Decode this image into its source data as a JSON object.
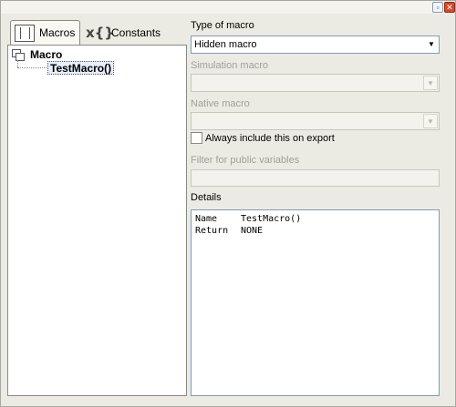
{
  "window": {
    "restore_glyph": "▫",
    "close_glyph": "✕"
  },
  "left": {
    "tabs": [
      {
        "label": "Macros",
        "icon": "macros-icon",
        "active": true
      },
      {
        "label": "Constants",
        "icon": "constants-icon",
        "active": false
      }
    ],
    "constants_icon_glyph": "x{}",
    "tree": {
      "root_label": "Macro",
      "child_label": "TestMacro()"
    }
  },
  "right": {
    "type_label": "Type of macro",
    "type_value": "Hidden macro",
    "simulation_label": "Simulation macro",
    "simulation_value": "",
    "native_label": "Native macro",
    "native_value": "",
    "include_label": "Always include this on export",
    "include_checked": false,
    "filter_label": "Filter for public variables",
    "filter_value": "",
    "details_label": "Details",
    "details_rows": [
      {
        "key": "Name",
        "value": "TestMacro()"
      },
      {
        "key": "Return",
        "value": "NONE"
      }
    ]
  },
  "icons": {
    "dropdown_glyph": "▼"
  },
  "colors": {
    "window_bg": "#ecebe3",
    "selection_bg": "#e8eefb",
    "input_border": "#7f9db9",
    "disabled_text": "#a19f96",
    "close_button": "#d9492a"
  }
}
